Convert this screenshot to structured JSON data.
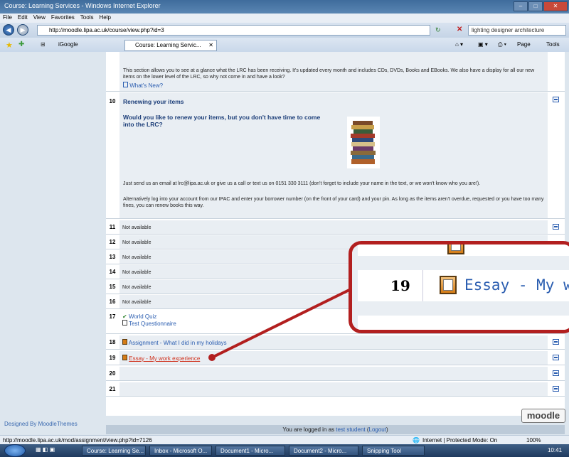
{
  "window": {
    "title": "Course: Learning Services - Windows Internet Explorer"
  },
  "menu": [
    "File",
    "Edit",
    "View",
    "Favorites",
    "Tools",
    "Help"
  ],
  "address": {
    "url": "http://moodle.lipa.ac.uk/course/view.php?id=3",
    "search": "lighting designer architecture"
  },
  "tabs": {
    "igoogle": "iGoogle",
    "current": "Course: Learning Servic...",
    "toolbar_page": "Page",
    "toolbar_tools": "Tools"
  },
  "sections": {
    "whats_new": {
      "text": "This section allows you to see at a glance what the LRC has been receiving. It's updated every month and includes CDs, DVDs, Books and EBooks. We also have a display for all our new items on the lower level of the LRC, so why not come in and have a look?",
      "link": "What's New?"
    },
    "renew": {
      "num": "10",
      "title": "Renewing your items",
      "question": "Would you like to renew your items, but you don't have time to come into the LRC?",
      "p1": "Just send us an email at lrc@lipa.ac.uk or give us a call or text us on 0151 330 3111 (don't forget to include your name in the text, or we won't know who you are!).",
      "p2": "Alternatively log into your account from our IPAC and enter your borrower number (on the front of your card) and your pin. As long as the items aren't overdue, requested or you have too many fines, you can renew books this way."
    },
    "na": [
      {
        "num": "11",
        "label": "Not available"
      },
      {
        "num": "12",
        "label": "Not available"
      },
      {
        "num": "13",
        "label": "Not available"
      },
      {
        "num": "14",
        "label": "Not available"
      },
      {
        "num": "15",
        "label": "Not available"
      },
      {
        "num": "16",
        "label": "Not available"
      }
    ],
    "s17": {
      "num": "17",
      "quiz": "World Quiz",
      "questionnaire": "Test Questionnaire"
    },
    "s18": {
      "num": "18",
      "assignment": "Assignment - What I did in my holidays"
    },
    "s19": {
      "num": "19",
      "essay": "Essay - My work experience"
    },
    "s20": {
      "num": "20"
    },
    "s21": {
      "num": "21"
    }
  },
  "zoom": {
    "num": "19",
    "text": "Essay - My w"
  },
  "footer": {
    "designed": "Designed By MoodleThemes",
    "logged_prefix": "You are logged in as",
    "user": "test student",
    "logout": "Logout",
    "logo": "moodle"
  },
  "status": {
    "url": "http://moodle.lipa.ac.uk/mod/assignment/view.php?id=7126",
    "zone": "Internet | Protected Mode: On",
    "zoom": "100%"
  },
  "taskbar": {
    "items": [
      "Course: Learning Se...",
      "Inbox - Microsoft O...",
      "Document1 - Micro...",
      "Document2 - Micro...",
      "Snipping Tool"
    ],
    "time": "10:41"
  },
  "colors": {
    "callout": "#b21f1f",
    "link": "#2a5db0",
    "heading": "#1b3d78"
  }
}
